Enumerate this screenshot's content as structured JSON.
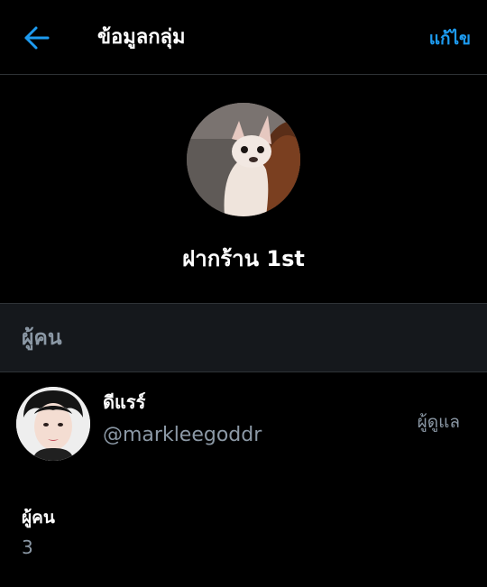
{
  "header": {
    "title": "ข้อมูลกลุ่ม",
    "edit_label": "แก้ไข",
    "back_icon": "arrow-left-icon"
  },
  "group": {
    "name": "ฝากร้าน 1st",
    "avatar": "group-avatar-chihuahua"
  },
  "people_section": {
    "title": "ผู้คน"
  },
  "members": [
    {
      "name": "ดีแรร์",
      "handle": "@markleegoddr",
      "role": "ผู้ดูแล",
      "avatar": "member-avatar-photo"
    }
  ],
  "people_count": {
    "label": "ผู้คน",
    "value": "3"
  },
  "colors": {
    "accent": "#1d9bf0",
    "background": "#000000",
    "section_background": "#15181c",
    "secondary_text": "#8b98a5",
    "divider": "#2f3336"
  }
}
